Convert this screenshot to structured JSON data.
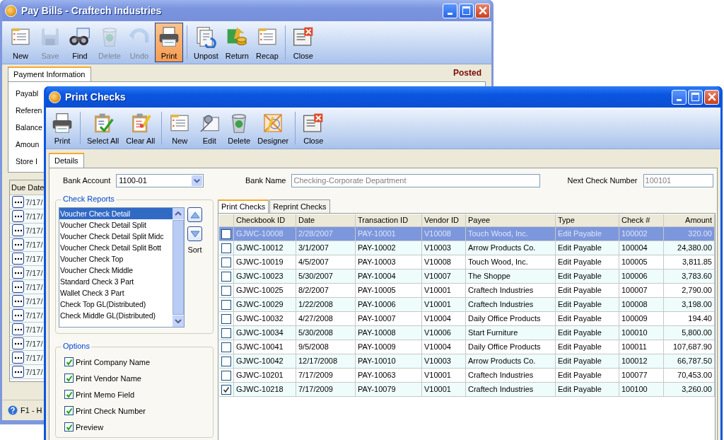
{
  "back_window": {
    "title": "Pay Bills - Craftech Industries",
    "toolbar": [
      [
        {
          "label": "New",
          "disabled": false,
          "selected": false
        },
        {
          "label": "Save",
          "disabled": true,
          "selected": false
        },
        {
          "label": "Find",
          "disabled": false,
          "selected": false
        },
        {
          "label": "Delete",
          "disabled": true,
          "selected": false
        },
        {
          "label": "Undo",
          "disabled": true,
          "selected": false
        },
        {
          "label": "Print",
          "disabled": false,
          "selected": true
        }
      ],
      [
        {
          "label": "Unpost",
          "disabled": false,
          "selected": false
        },
        {
          "label": "Return",
          "disabled": false,
          "selected": false
        },
        {
          "label": "Recap",
          "disabled": false,
          "selected": false
        }
      ],
      [
        {
          "label": "Close",
          "disabled": false,
          "selected": false
        }
      ]
    ],
    "tabs": [
      {
        "label": "Payment Information",
        "selected": true
      }
    ],
    "status": "Posted",
    "fields": [
      "Payabl",
      "Referen",
      "Balance",
      "Amoun",
      "Store I"
    ],
    "grid": {
      "columns": [
        "Due Date"
      ],
      "rows": [
        "7/17/",
        "7/17/",
        "7/17/",
        "7/17/",
        "7/17/",
        "7/17/",
        "7/17/",
        "7/17/",
        "7/17/",
        "7/17/",
        "7/17/",
        "7/17/",
        "7/17/"
      ]
    },
    "status_bar": "F1 - H"
  },
  "front_window": {
    "title": "Print Checks",
    "toolbar": [
      [
        {
          "label": "Print",
          "disabled": false,
          "selected": false
        }
      ],
      [
        {
          "label": "Select All",
          "disabled": false,
          "selected": false
        },
        {
          "label": "Clear All",
          "disabled": false,
          "selected": false
        }
      ],
      [
        {
          "label": "New",
          "disabled": false,
          "selected": false
        },
        {
          "label": "Edit",
          "disabled": false,
          "selected": false
        },
        {
          "label": "Delete",
          "disabled": false,
          "selected": false
        },
        {
          "label": "Designer",
          "disabled": false,
          "selected": false
        }
      ],
      [
        {
          "label": "Close",
          "disabled": false,
          "selected": false
        }
      ]
    ],
    "tabs": [
      {
        "label": "Details",
        "selected": true
      }
    ],
    "bank_account": {
      "label": "Bank Account",
      "value": "1100-01"
    },
    "bank_name": {
      "label": "Bank Name",
      "value": "Checking-Corporate Department"
    },
    "next_check_number": {
      "label": "Next Check Number",
      "value": "100101"
    },
    "check_reports": {
      "title": "Check Reports",
      "sort_label": "Sort",
      "items": [
        {
          "label": "Voucher Check Detail",
          "selected": true
        },
        {
          "label": "Voucher Check Detail Split",
          "selected": false
        },
        {
          "label": "Voucher Check Detail Split Midc",
          "selected": false
        },
        {
          "label": "Voucher Check Detail Split Bott",
          "selected": false
        },
        {
          "label": "Voucher Check Top",
          "selected": false
        },
        {
          "label": "Voucher Check Middle",
          "selected": false
        },
        {
          "label": "Standard Check 3 Part",
          "selected": false
        },
        {
          "label": "Wallet Check 3 Part",
          "selected": false
        },
        {
          "label": "Check Top GL(Distributed)",
          "selected": false
        },
        {
          "label": "Check Middle GL(Distributed)",
          "selected": false
        }
      ]
    },
    "options": {
      "title": "Options",
      "items": [
        {
          "label": "Print Company Name",
          "checked": true
        },
        {
          "label": "Print Vendor Name",
          "checked": true
        },
        {
          "label": "Print Memo Field",
          "checked": true
        },
        {
          "label": "Print Check Number",
          "checked": true
        },
        {
          "label": "Preview",
          "checked": true
        }
      ]
    },
    "grid_tabs": [
      {
        "label": "Print Checks",
        "selected": true
      },
      {
        "label": "Reprint Checks",
        "selected": false
      }
    ],
    "table": {
      "columns": [
        "Checkbook ID",
        "Date",
        "Transaction ID",
        "Vendor ID",
        "Payee",
        "Type",
        "Check #",
        "Amount"
      ],
      "rows": [
        {
          "selected": true,
          "checked": false,
          "cells": [
            "GJWC-10008",
            "2/28/2007",
            "PAY-10001",
            "V10008",
            "Touch Wood, Inc.",
            "Edit Payable",
            "100002",
            "320.00"
          ]
        },
        {
          "selected": false,
          "checked": false,
          "cells": [
            "GJWC-10012",
            "3/1/2007",
            "PAY-10002",
            "V10003",
            "Arrow Products Co.",
            "Edit Payable",
            "100004",
            "24,380.00"
          ]
        },
        {
          "selected": false,
          "checked": false,
          "cells": [
            "GJWC-10019",
            "4/5/2007",
            "PAY-10003",
            "V10008",
            "Touch Wood, Inc.",
            "Edit Payable",
            "100005",
            "3,811.85"
          ]
        },
        {
          "selected": false,
          "checked": false,
          "cells": [
            "GJWC-10023",
            "5/30/2007",
            "PAY-10004",
            "V10007",
            "The Shoppe",
            "Edit Payable",
            "100006",
            "3,783.60"
          ]
        },
        {
          "selected": false,
          "checked": false,
          "cells": [
            "GJWC-10025",
            "8/2/2007",
            "PAY-10005",
            "V10001",
            "Craftech Industries",
            "Edit Payable",
            "100007",
            "2,790.00"
          ]
        },
        {
          "selected": false,
          "checked": false,
          "cells": [
            "GJWC-10029",
            "1/22/2008",
            "PAY-10006",
            "V10001",
            "Craftech Industries",
            "Edit Payable",
            "100008",
            "3,198.00"
          ]
        },
        {
          "selected": false,
          "checked": false,
          "cells": [
            "GJWC-10032",
            "4/27/2008",
            "PAY-10007",
            "V10004",
            "Daily Office Products",
            "Edit Payable",
            "100009",
            "194.40"
          ]
        },
        {
          "selected": false,
          "checked": false,
          "cells": [
            "GJWC-10034",
            "5/30/2008",
            "PAY-10008",
            "V10006",
            "Start Furniture",
            "Edit Payable",
            "100010",
            "5,800.00"
          ]
        },
        {
          "selected": false,
          "checked": false,
          "cells": [
            "GJWC-10041",
            "9/5/2008",
            "PAY-10009",
            "V10004",
            "Daily Office Products",
            "Edit Payable",
            "100011",
            "107,687.90"
          ]
        },
        {
          "selected": false,
          "checked": false,
          "cells": [
            "GJWC-10042",
            "12/17/2008",
            "PAY-10010",
            "V10003",
            "Arrow Products Co.",
            "Edit Payable",
            "100012",
            "66,787.50"
          ]
        },
        {
          "selected": false,
          "checked": false,
          "cells": [
            "GJWC-10201",
            "7/17/2009",
            "PAY-10063",
            "V10001",
            "Craftech Industries",
            "Edit Payable",
            "100077",
            "70,453.00"
          ]
        },
        {
          "selected": false,
          "checked": true,
          "cells": [
            "GJWC-10218",
            "7/17/2009",
            "PAY-10079",
            "V10001",
            "Craftech Industries",
            "Edit Payable",
            "100100",
            "3,260.00"
          ]
        }
      ]
    }
  }
}
